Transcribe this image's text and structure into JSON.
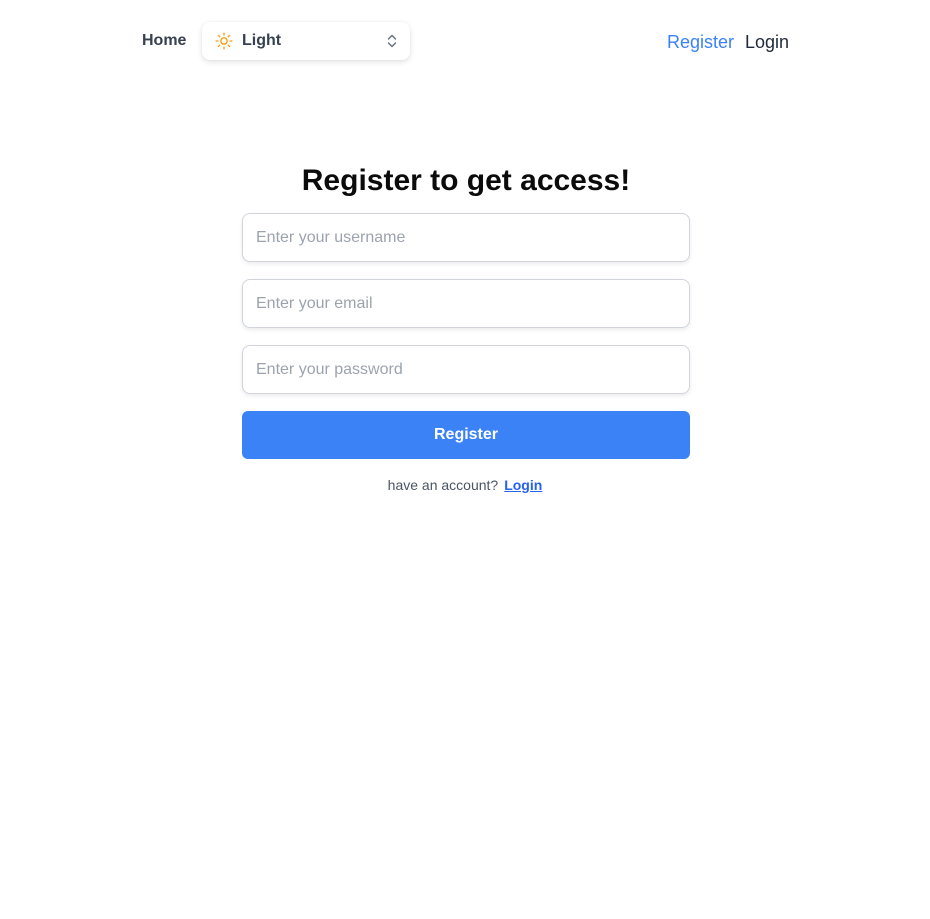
{
  "header": {
    "home_label": "Home",
    "theme_select": {
      "icon": "sun-icon",
      "selected": "Light",
      "icon_color": "#f59e0b"
    },
    "register_label": "Register",
    "login_label": "Login",
    "register_color": "#3b82f6"
  },
  "form": {
    "title": "Register to get access!",
    "username_placeholder": "Enter your username",
    "email_placeholder": "Enter your email",
    "password_placeholder": "Enter your password",
    "submit_label": "Register",
    "submit_color": "#3b82f6",
    "footer_text": "have an account?",
    "footer_link": "Login"
  }
}
